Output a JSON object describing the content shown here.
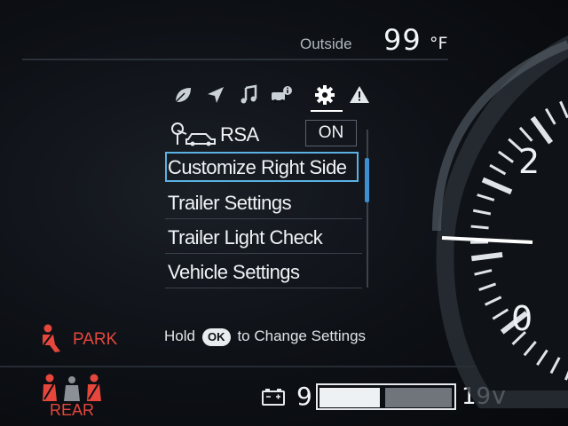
{
  "outside": {
    "label": "Outside",
    "value": "99",
    "unit": "°F"
  },
  "tabs": [
    {
      "icon": "leaf-icon"
    },
    {
      "icon": "navigation-arrow-icon"
    },
    {
      "icon": "music-note-icon"
    },
    {
      "icon": "vehicle-info-icon"
    },
    {
      "icon": "gear-icon",
      "selected": true
    },
    {
      "icon": "warning-icon"
    }
  ],
  "menu": {
    "rsa": {
      "label": "RSA",
      "status": "ON"
    },
    "items": [
      {
        "label": "Customize Right Side",
        "selected": true
      },
      {
        "label": "Trailer Settings"
      },
      {
        "label": "Trailer Light Check"
      },
      {
        "label": "Vehicle Settings"
      }
    ],
    "scroll_position": 0.25
  },
  "hint": {
    "prefix": "Hold",
    "button": "OK",
    "suffix": "to Change Settings"
  },
  "indicators": {
    "park": "PARK",
    "rear": "REAR",
    "color": "#e5473d"
  },
  "battery": {
    "min": "9",
    "max": "19V",
    "level": 0.45
  },
  "gauge": {
    "ticks": [
      "2",
      "0"
    ],
    "accent": "#ffffff"
  },
  "colors": {
    "accent": "#5bb1e3",
    "warning": "#e5473d"
  }
}
